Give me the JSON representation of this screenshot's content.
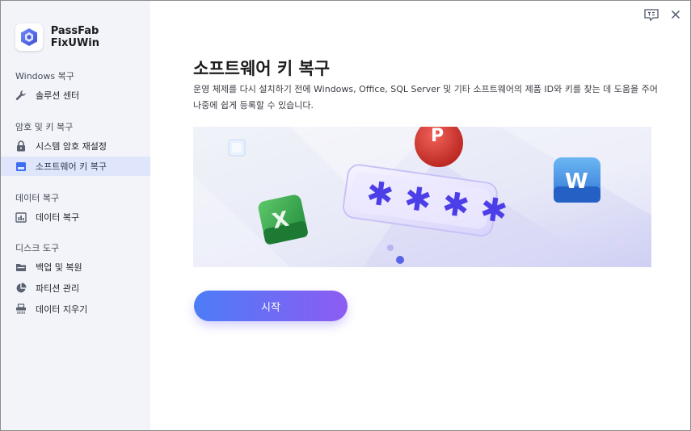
{
  "app": {
    "name": "PassFab FixUWin"
  },
  "sidebar": {
    "sections": [
      {
        "title": "Windows 복구",
        "items": [
          {
            "label": "솔루션 센터",
            "icon": "wrench-icon"
          }
        ]
      },
      {
        "title": "암호 및 키 복구",
        "items": [
          {
            "label": "시스템 암호 재설정",
            "icon": "lock-icon"
          },
          {
            "label": "소프트웨어 키 복구",
            "icon": "key-card-icon",
            "active": true
          }
        ]
      },
      {
        "title": "데이터 복구",
        "items": [
          {
            "label": "데이터 복구",
            "icon": "bar-chart-icon"
          }
        ]
      },
      {
        "title": "디스크 도구",
        "items": [
          {
            "label": "백업 및 복원",
            "icon": "folder-icon"
          },
          {
            "label": "파티션 관리",
            "icon": "pie-chart-icon"
          },
          {
            "label": "데이터 지우기",
            "icon": "shredder-icon"
          }
        ]
      }
    ]
  },
  "main": {
    "title": "소프트웨어 키 복구",
    "description": "운영 체제를 다시 설치하기 전에 Windows, Office, SQL Server 및 기타 소프트웨어의 제품 ID와 키를 찾는 데 도움을 주어 나중에 쉽게 등록할 수 있습니다.",
    "start_label": "시작"
  },
  "banner": {
    "badges": [
      "P",
      "W",
      "X"
    ],
    "password_mask": "****"
  },
  "colors": {
    "accent_start": "#4c7cf6",
    "accent_end": "#8d5cf2",
    "sidebar_bg": "#f2f4fa",
    "active_bg": "#dfe5fb"
  }
}
